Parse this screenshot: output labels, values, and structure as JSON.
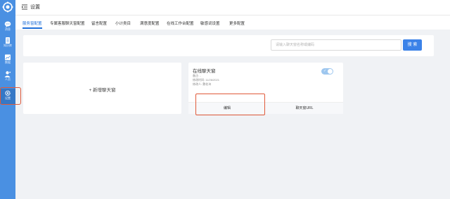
{
  "sidebar": {
    "logo": "gear-logo-icon",
    "items": [
      {
        "label": "消息",
        "icon": "chat-bubble-icon"
      },
      {
        "label": "知识库",
        "icon": "document-icon"
      },
      {
        "label": "数据",
        "icon": "chart-icon"
      },
      {
        "label": "人员",
        "icon": "person-icon"
      },
      {
        "label": "设置",
        "icon": "gear-icon"
      }
    ]
  },
  "header": {
    "title": "设置",
    "menu_icon": "menu-collapse-icon"
  },
  "tabs": [
    "服务窗配置",
    "专属客服聊天窗配置",
    "留言配置",
    "小计类目",
    "满意度配置",
    "在线工作台配置",
    "敏感词设置",
    "更多配置"
  ],
  "search": {
    "placeholder": "请输入聊天窗名称或编码",
    "button": "搜 索"
  },
  "add_card": {
    "label": "+ 新增聊天窗"
  },
  "chat_card": {
    "title": "在线聊天窗",
    "note": "备注: -",
    "modified_time": "修改时间: 11/26/2021",
    "modifier": "修改人: 敷花诗",
    "toggle_on": true,
    "edit_label": "编辑",
    "url_label": "聊天窗URL"
  },
  "colors": {
    "sidebar": "#4a90e2",
    "accent": "#3b82e8",
    "highlight": "#e05a3a"
  }
}
